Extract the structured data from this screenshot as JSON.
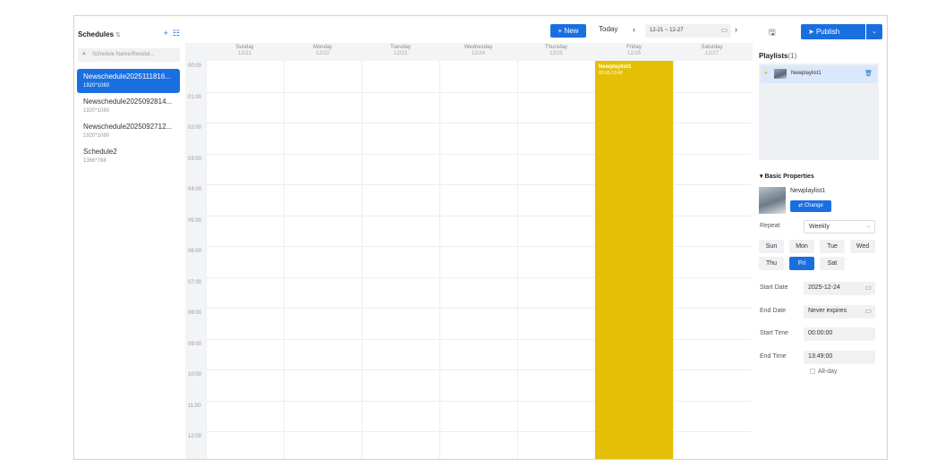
{
  "left": {
    "title": "Schedules",
    "search_placeholder": "Schedule Name/Resolut...",
    "schedules": [
      {
        "name": "Newschedule2025111816...",
        "res": "1920*1080",
        "active": true
      },
      {
        "name": "Newschedule2025092814...",
        "res": "1920*1080",
        "active": false
      },
      {
        "name": "Newschedule2025092712...",
        "res": "1920*1080",
        "active": false
      },
      {
        "name": "Schedule2",
        "res": "1366*768",
        "active": false
      }
    ]
  },
  "toolbar": {
    "new_label": "+ New",
    "today_label": "Today",
    "range": "12-21 ~ 12-27",
    "prev": "‹",
    "next": "›"
  },
  "days": [
    {
      "name": "Sunday",
      "date": "12/21"
    },
    {
      "name": "Monday",
      "date": "12/22"
    },
    {
      "name": "Tuesday",
      "date": "12/23"
    },
    {
      "name": "Wednesday",
      "date": "12/24"
    },
    {
      "name": "Thursday",
      "date": "12/25"
    },
    {
      "name": "Friday",
      "date": "12/26"
    },
    {
      "name": "Saturday",
      "date": "12/27"
    }
  ],
  "times": [
    "00:00",
    "01:00",
    "02:00",
    "03:00",
    "04:00",
    "05:00",
    "06:00",
    "07:00",
    "08:00",
    "09:00",
    "10:00",
    "11:00",
    "12:00"
  ],
  "event": {
    "name": "Newplaylist1",
    "time": "00:00-13:49"
  },
  "right": {
    "publish_label": "Publish",
    "playlists_title": "Playlists",
    "playlists_count": "(1)",
    "playlist_name": "Newplaylist1",
    "basic_props_title": "Basic Properties",
    "prop_name": "Newplaylist1",
    "change_label": "⇄ Change",
    "repeat_label": "Repeat",
    "repeat_value": "Weekly",
    "weekdays": [
      "Sun",
      "Mon",
      "Tue",
      "Wed",
      "Thu",
      "Fri",
      "Sat"
    ],
    "selected_weekday": "Fri",
    "start_date_label": "Start Date",
    "start_date": "2025-12-24",
    "end_date_label": "End Date",
    "end_date": "Never expires",
    "start_time_label": "Start Time",
    "start_time": "00:00:00",
    "end_time_label": "End Time",
    "end_time": "13:49:00",
    "allday_label": "All-day"
  },
  "colors": {
    "accent": "#1a6fe0",
    "event": "#e5bf06"
  }
}
